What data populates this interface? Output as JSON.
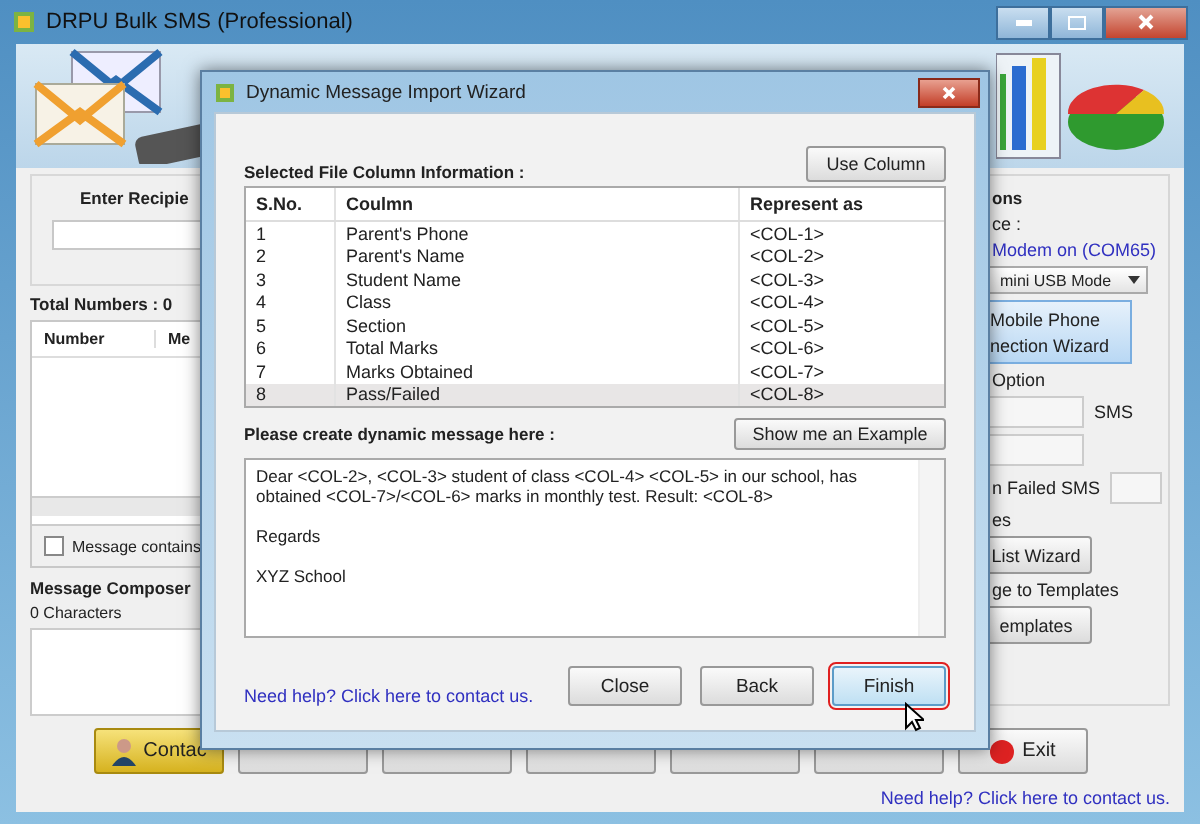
{
  "main_window": {
    "title": "DRPU Bulk SMS (Professional)",
    "left": {
      "recipient_label": "Enter Recipie",
      "total_numbers": "Total Numbers : 0",
      "grid_columns": [
        "Number",
        "Me"
      ],
      "contains_checkbox": {
        "label": "Message contains",
        "checked": false
      },
      "composer_label": "Message Composer",
      "char_count": "0 Characters"
    },
    "right": {
      "heading": "ons",
      "device_label": "ce :",
      "modem_status": "Modem on (COM65)",
      "mode_dropdown": "mini USB Mode",
      "wizard_panel": [
        "Mobile Phone",
        "nection  Wizard"
      ],
      "option_label": "Option",
      "sms_label": "SMS",
      "failed_label": "n Failed SMS",
      "es_label": "es",
      "list_wizard_button": "List Wizard",
      "templates_label": "ge to Templates",
      "templates_button": "emplates"
    },
    "toolbar": [
      {
        "kind": "contacts",
        "label": "Contac"
      },
      {
        "kind": "plain"
      },
      {
        "kind": "plain"
      },
      {
        "kind": "plain"
      },
      {
        "kind": "plain"
      },
      {
        "kind": "plain"
      },
      {
        "kind": "exit",
        "label": "Exit"
      }
    ],
    "help_link": "Need help? Click here to contact us."
  },
  "dialog": {
    "title": "Dynamic Message Import Wizard",
    "section_label": "Selected File Column Information :",
    "use_column_button": "Use Column",
    "table": {
      "columns": [
        "S.No.",
        "Coulmn",
        "Represent as"
      ],
      "rows": [
        {
          "cells": [
            "1",
            "Parent's Phone",
            "<COL-1>"
          ],
          "selected": false
        },
        {
          "cells": [
            "2",
            "Parent's Name",
            "<COL-2>"
          ],
          "selected": false
        },
        {
          "cells": [
            "3",
            "Student Name",
            "<COL-3>"
          ],
          "selected": false
        },
        {
          "cells": [
            "4",
            "Class",
            "<COL-4>"
          ],
          "selected": false
        },
        {
          "cells": [
            "5",
            "Section",
            "<COL-5>"
          ],
          "selected": false
        },
        {
          "cells": [
            "6",
            "Total Marks",
            "<COL-6>"
          ],
          "selected": false
        },
        {
          "cells": [
            "7",
            "Marks Obtained",
            "<COL-7>"
          ],
          "selected": false
        },
        {
          "cells": [
            "8",
            "Pass/Failed",
            "<COL-8>"
          ],
          "selected": true
        }
      ]
    },
    "message_label": "Please create dynamic message here :",
    "example_button": "Show me an Example",
    "message": "Dear <COL-2>, <COL-3> student of class <COL-4> <COL-5> in our school, has obtained <COL-7>/<COL-6> marks in monthly test. Result: <COL-8>\n\nRegards\n\nXYZ School",
    "help_link": "Need help? Click here to contact us.",
    "buttons": [
      {
        "label": "Close",
        "highlighted": false
      },
      {
        "label": "Back",
        "highlighted": false
      },
      {
        "label": "Finish",
        "highlighted": true
      }
    ]
  }
}
